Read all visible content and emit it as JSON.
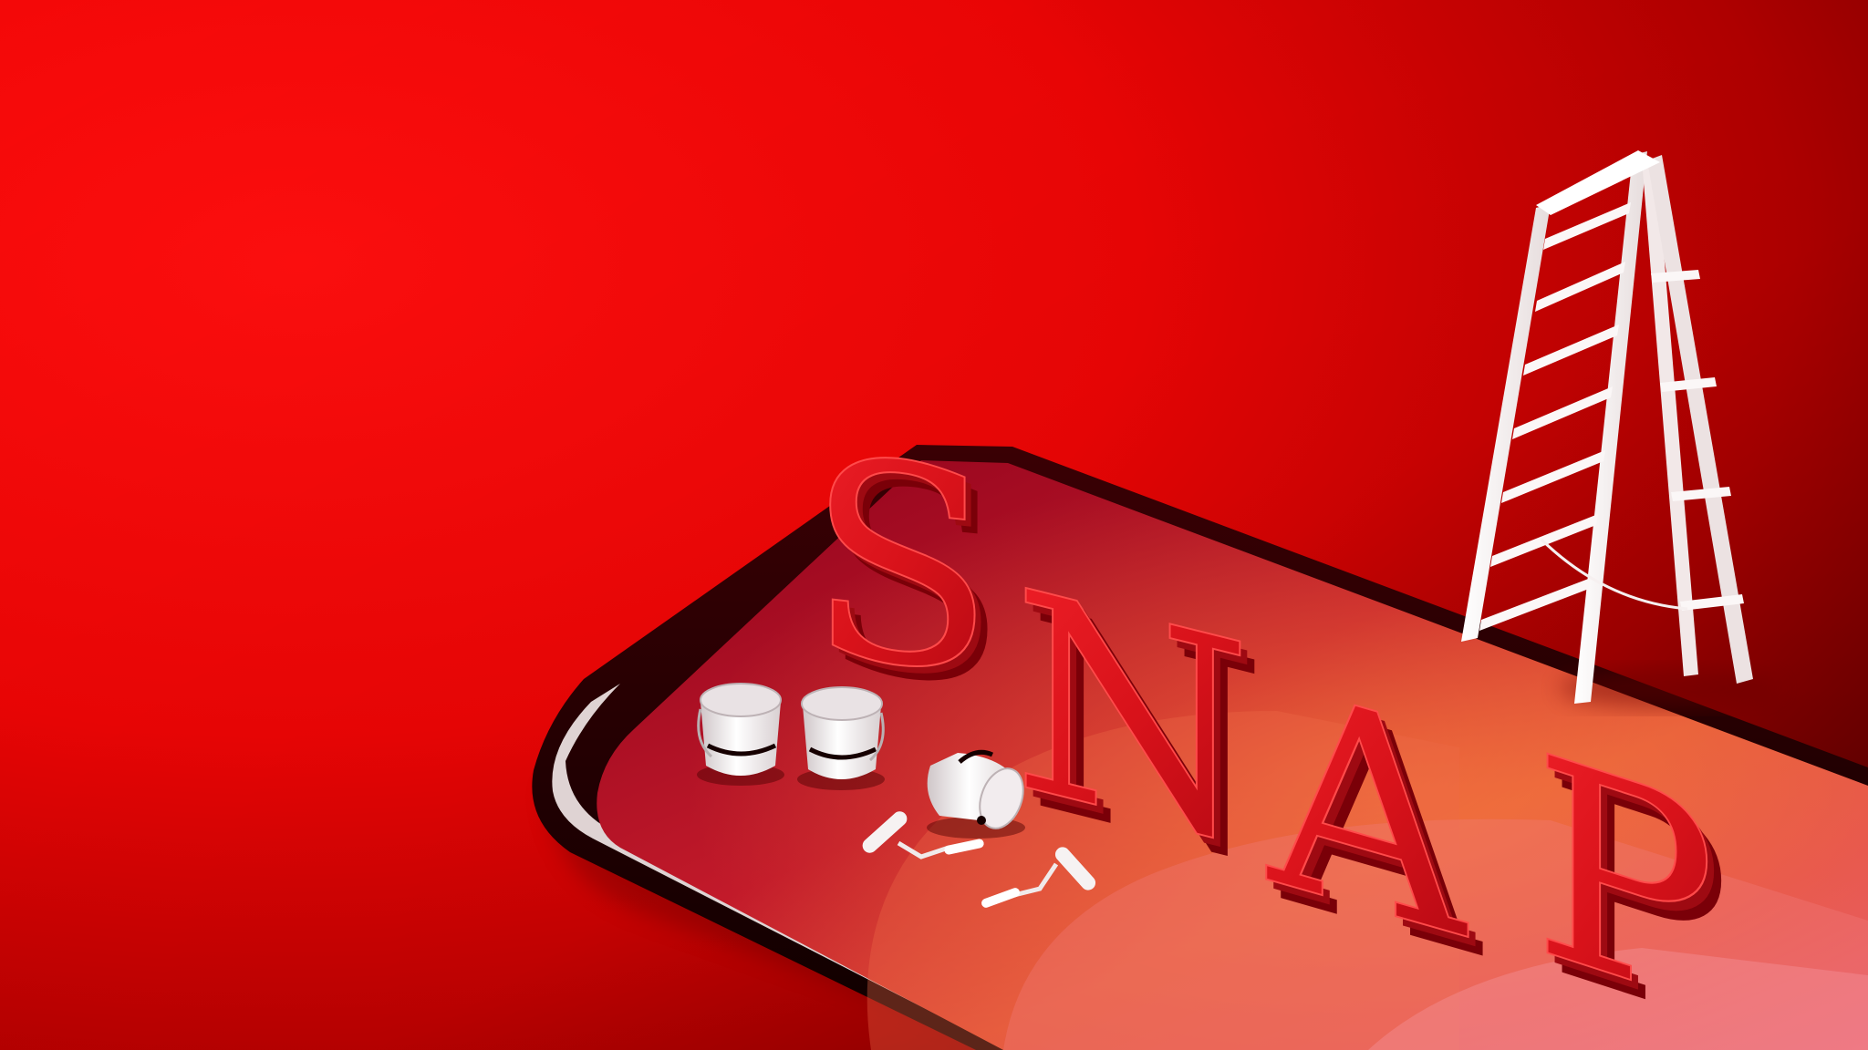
{
  "scene": {
    "headline_letters": [
      "S",
      "N",
      "A",
      "P"
    ],
    "objects": [
      "smartphone",
      "ladder",
      "paint-bucket",
      "paint-bucket",
      "paint-bucket",
      "paint-roller",
      "paint-roller"
    ]
  },
  "colors": {
    "background_bright": "#ff0a0a",
    "background_dark": "#7a0000",
    "letter_face": "#e0141a",
    "letter_side": "#8c0008",
    "screen_warm": "#f0603a",
    "screen_pink": "#e64a6a",
    "phone_bezel": "#1a0000",
    "white_props": "#f4f0f0"
  }
}
